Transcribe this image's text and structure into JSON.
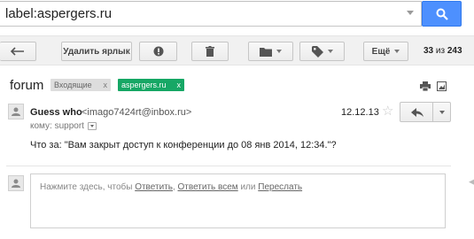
{
  "search": {
    "value": "label:aspergers.ru"
  },
  "toolbar": {
    "remove_label": "Удалить ярлык",
    "more_label": "Ещё",
    "counter_range": "33",
    "counter_sep": "из",
    "counter_total": "243"
  },
  "thread": {
    "subject": "forum",
    "labels": [
      {
        "name": "Входящие",
        "remove": "x",
        "color": "#dddddd"
      },
      {
        "name": "aspergers.ru",
        "remove": "x",
        "color": "#16a765"
      }
    ]
  },
  "message": {
    "sender_name": "Guess who",
    "sender_email": "<imago7424rt@inbox.ru>",
    "to": "кому: support",
    "date": "12.12.13",
    "body": "Что за: \"Вам закрыт доступ к конференции до 08 янв 2014, 12:34.\"?"
  },
  "reply_box": {
    "prompt_prefix": "Нажмите здесь, чтобы ",
    "reply": "Ответить",
    "sep1": ", ",
    "reply_all": "Ответить всем",
    "or": " или ",
    "forward": "Переслать"
  },
  "colors": {
    "accent": "#4d90fe",
    "label_green": "#16a765"
  }
}
